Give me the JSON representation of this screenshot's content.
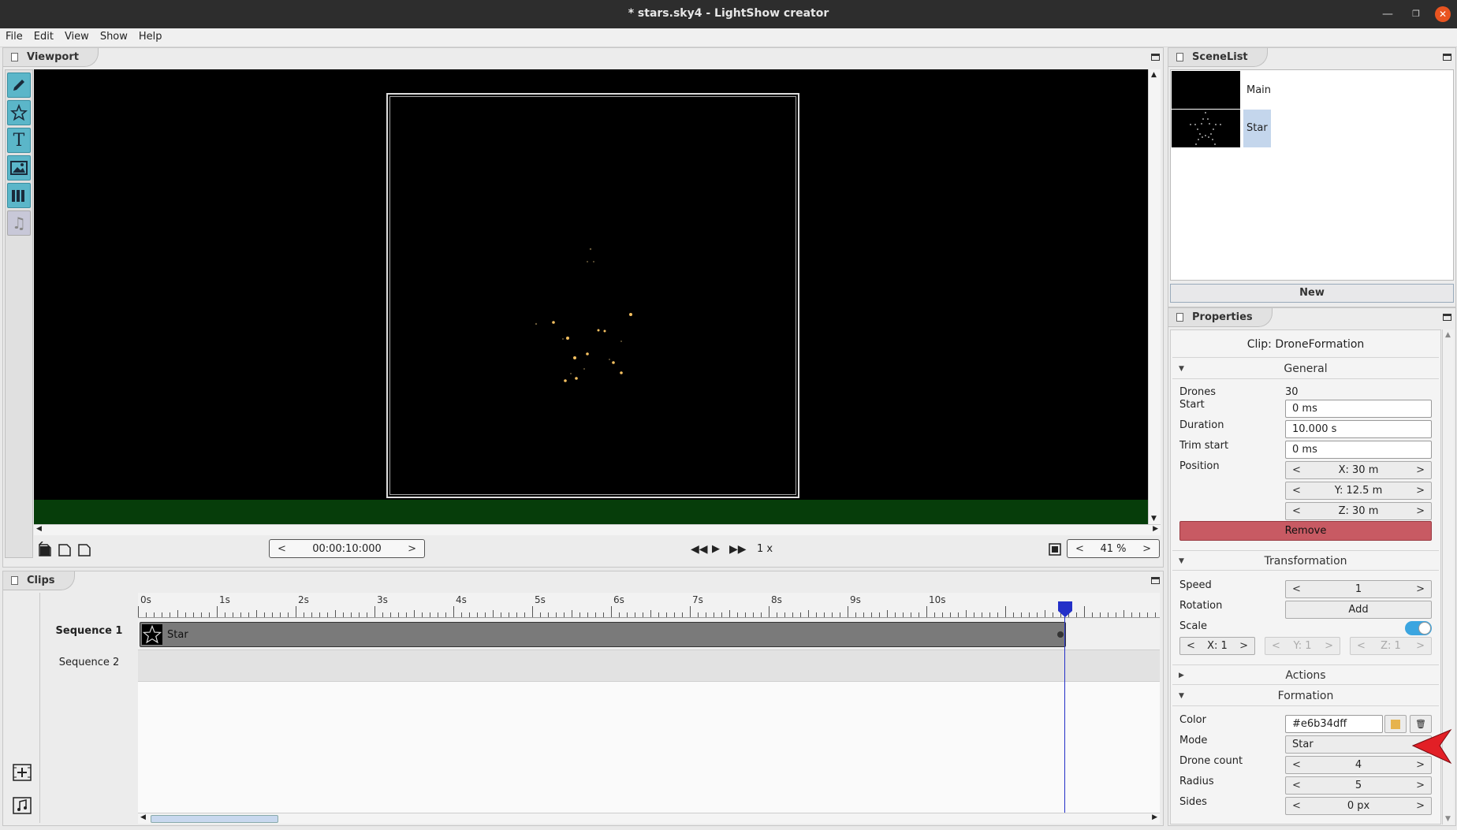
{
  "window": {
    "title": "* stars.sky4 - LightShow creator"
  },
  "menu": [
    "File",
    "Edit",
    "View",
    "Show",
    "Help"
  ],
  "viewport": {
    "tab": "Viewport",
    "time": "00:00:10:000",
    "speed": "1 x",
    "zoom": "41 %"
  },
  "clips": {
    "tab": "Clips",
    "ruler_labels": [
      "0s",
      "1s",
      "2s",
      "3s",
      "4s",
      "5s",
      "6s",
      "7s",
      "8s",
      "9s",
      "10s"
    ],
    "sequences": [
      "Sequence 1",
      "Sequence 2"
    ],
    "clip_label": "Star",
    "playhead_seconds": 10.0
  },
  "scenelist": {
    "tab": "SceneList",
    "scenes": [
      "Main",
      "Star"
    ],
    "new_label": "New"
  },
  "properties": {
    "tab": "Properties",
    "header": "Clip: DroneFormation",
    "general": {
      "title": "General",
      "drones_label": "Drones",
      "drones_value": "30",
      "start_label": "Start",
      "start_value": "0 ms",
      "duration_label": "Duration",
      "duration_value": "10.000 s",
      "trim_label": "Trim start",
      "trim_value": "0 ms",
      "position_label": "Position",
      "pos_x": "X: 30 m",
      "pos_y": "Y: 12.5 m",
      "pos_z": "Z: 30 m",
      "remove_label": "Remove"
    },
    "transformation": {
      "title": "Transformation",
      "speed_label": "Speed",
      "speed_value": "1",
      "rotation_label": "Rotation",
      "rotation_button": "Add",
      "scale_label": "Scale",
      "scale_x": "X: 1",
      "scale_y": "Y: 1",
      "scale_z": "Z: 1",
      "scale_toggle_on": true
    },
    "actions": {
      "title": "Actions"
    },
    "formation": {
      "title": "Formation",
      "color_label": "Color",
      "color_value": "#e6b34dff",
      "swatch": "#e6b34d",
      "mode_label": "Mode",
      "mode_value": "Star",
      "count_label": "Drone count",
      "count_value": "4",
      "radius_label": "Radius",
      "radius_value": "5",
      "sides_label": "Sides",
      "sides_value": "0 px"
    }
  },
  "colors": {
    "accent": "#5bb6c9",
    "remove": "#c85a63",
    "toggle": "#3ba5e0",
    "playhead": "#2430c8"
  }
}
